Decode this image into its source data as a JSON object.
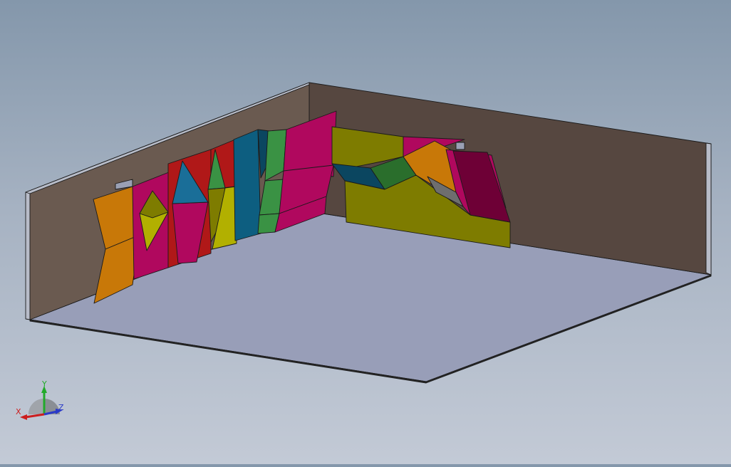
{
  "viewport": {
    "background_top": "#8497ab",
    "background_bottom": "#c3cad6"
  },
  "triad": {
    "x_label": "X",
    "y_label": "Y",
    "z_label": "Z",
    "x_color": "#cc1e1e",
    "y_color": "#22aa2a",
    "z_color": "#2a3ac8"
  },
  "colors": {
    "floor": "#989eb8",
    "back_wall": "#564740",
    "left_wall": "#6a5a50",
    "wall_edge": "#b8bcc8",
    "orange": "#c87808",
    "magenta": "#b0085e",
    "yellow": "#b2b000",
    "olive": "#7e7c00",
    "teal": "#0d5e80",
    "blue": "#1a6e98",
    "green": "#3a9244",
    "red": "#b01818",
    "dark_green": "#2a6e2c",
    "dark_teal": "#0b4660",
    "wine": "#6e0036"
  }
}
